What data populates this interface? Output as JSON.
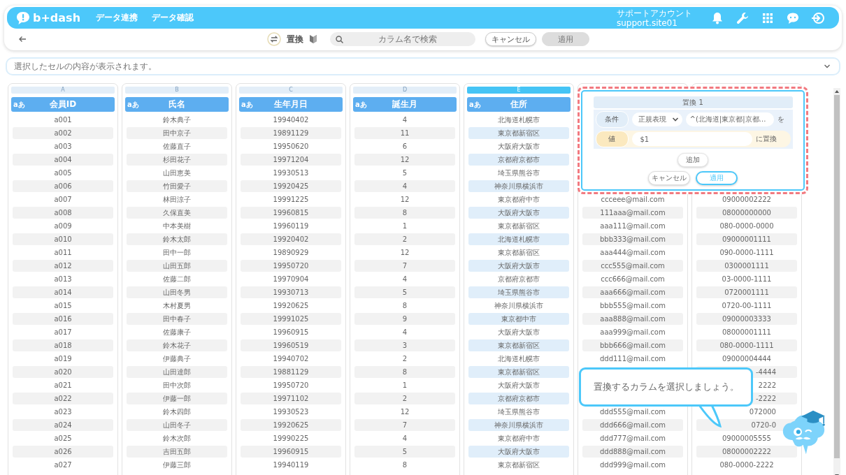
{
  "app": {
    "logo": "b+dash",
    "nav": [
      {
        "label": "データ連携"
      },
      {
        "label": "データ確認"
      }
    ],
    "account": {
      "title": "サポートアカウント",
      "id": "support.site01"
    }
  },
  "toolbar": {
    "mode_label": "置換",
    "search": {
      "placeholder": "カラム名で検索"
    },
    "buttons": [
      {
        "label": "キャンセル",
        "disabled": false
      },
      {
        "label": "適用",
        "disabled": true
      }
    ]
  },
  "cell_view": {
    "placeholder": "選択したセルの内容が表示されます。"
  },
  "columns": [
    {
      "letter": "A",
      "title": "会員ID",
      "type": "aあ",
      "selected": false,
      "cells": [
        "a001",
        "a002",
        "a003",
        "a004",
        "a005",
        "a006",
        "a007",
        "a008",
        "a009",
        "a010",
        "a011",
        "a012",
        "a013",
        "a014",
        "a015",
        "a016",
        "a017",
        "a018",
        "a019",
        "a020",
        "a021",
        "a022",
        "a023",
        "a024",
        "a025",
        "a026",
        "a027"
      ]
    },
    {
      "letter": "B",
      "title": "氏名",
      "type": "aあ",
      "selected": false,
      "cells": [
        "鈴木典子",
        "田中京子",
        "佐藤直子",
        "杉田花子",
        "山田恵美",
        "竹田愛子",
        "林田涼子",
        "久保直美",
        "中本美樹",
        "鈴木太郎",
        "田中一郎",
        "山田五郎",
        "佐藤二郎",
        "山田冬男",
        "木村夏男",
        "田中春子",
        "佐藤康子",
        "鈴木花子",
        "伊藤典子",
        "山田達郎",
        "田中次郎",
        "伊藤一郎",
        "鈴木四郎",
        "山田冬子",
        "鈴木次郎",
        "吉田五郎",
        "伊藤三郎"
      ]
    },
    {
      "letter": "C",
      "title": "生年月日",
      "type": "aあ",
      "selected": false,
      "cells": [
        "19940402",
        "19891129",
        "19950620",
        "19971204",
        "19930513",
        "19920425",
        "19991225",
        "19960815",
        "19960119",
        "19920402",
        "19890929",
        "19950720",
        "19970904",
        "19930713",
        "19920625",
        "19991025",
        "19960915",
        "19960519",
        "19940702",
        "19881129",
        "19950720",
        "19971102",
        "19930523",
        "19920625",
        "19990225",
        "19960915",
        "19940119"
      ]
    },
    {
      "letter": "D",
      "title": "誕生月",
      "type": "aあ",
      "selected": false,
      "cells": [
        "4",
        "11",
        "6",
        "12",
        "5",
        "4",
        "12",
        "8",
        "1",
        "2",
        "12",
        "7",
        "4",
        "5",
        "8",
        "9",
        "4",
        "3",
        "2",
        "8",
        "1",
        "2",
        "12",
        "7",
        "4",
        "5",
        "8"
      ]
    },
    {
      "letter": "E",
      "title": "住所",
      "type": "aあ",
      "selected": true,
      "cells": [
        "北海道札幌市",
        "東京都新宿区",
        "大阪府大阪市",
        "京都府京都市",
        "埼玉県熊谷市",
        "神奈川県横浜市",
        "東京都府中市",
        "大阪府大阪市",
        "東京都新宿区",
        "北海道札幌市",
        "東京都新宿区",
        "大阪府大阪市",
        "京都府京都市",
        "埼玉県熊谷市",
        "神奈川県横浜市",
        "東京都中市",
        "大阪府大阪市",
        "東京都新宿区",
        "北海道札幌市",
        "東京都新宿区",
        "大阪府大阪市",
        "京都府京都市",
        "埼玉県熊谷市",
        "神奈川県横浜市",
        "東京都府中市",
        "大阪府大阪市",
        "東京都新宿区"
      ]
    },
    {
      "selected": false,
      "cells": [
        null,
        null,
        null,
        null,
        null,
        null,
        "ccceee@mail.com",
        "111aaa@mail.com",
        "aaa111@mail.com",
        "bbb333@mail.com",
        "aaa444@mail.com",
        "ccc555@mail.com",
        "ccc666@mail.com",
        "aaa666@mail.com",
        "bbb555@mail.com",
        "aaa888@mail.com",
        "aaa999@mail.com",
        "bbb666@mail.com",
        "ddd111@mail.com",
        null,
        null,
        null,
        "ddd555@mail.com",
        "ddd666@mail.com",
        "ddd777@mail.com",
        "ddd888@mail.com",
        "ddd999@mail.com"
      ]
    },
    {
      "selected": false,
      "cells": [
        null,
        null,
        null,
        null,
        null,
        null,
        "09000002222",
        "08000000000",
        "080-0000-0000",
        "09000001111",
        "090-0000-1111",
        "0300001111",
        "03-0000-1111",
        "0720001111",
        "0720-00-1111",
        "09000003333",
        "08000001111",
        "080-0000-1111",
        "09000004444",
        {
          "text": "-4444",
          "partial": true
        },
        {
          "text": "2222",
          "partial": true
        },
        {
          "text": "-2222",
          "partial": true
        },
        {
          "text": "072000",
          "partial": true
        },
        {
          "text": "0720-0",
          "partial": true
        },
        "09000005555",
        "08000002222",
        "080-0000-2222"
      ]
    }
  ],
  "replace_panel": {
    "title": "置換 1",
    "condition": {
      "label": "条件",
      "mode": "正規表現",
      "pattern": "^(北海道|東京都|京都…",
      "suffix": "を"
    },
    "value": {
      "label": "値",
      "text": "$1",
      "suffix": "に置換"
    },
    "add_button": "追加",
    "buttons": [
      {
        "label": "キャンセル",
        "primary": false
      },
      {
        "label": "適用",
        "primary": true
      }
    ]
  },
  "hint": {
    "text": "置換するカラムを選択しましょう。"
  }
}
